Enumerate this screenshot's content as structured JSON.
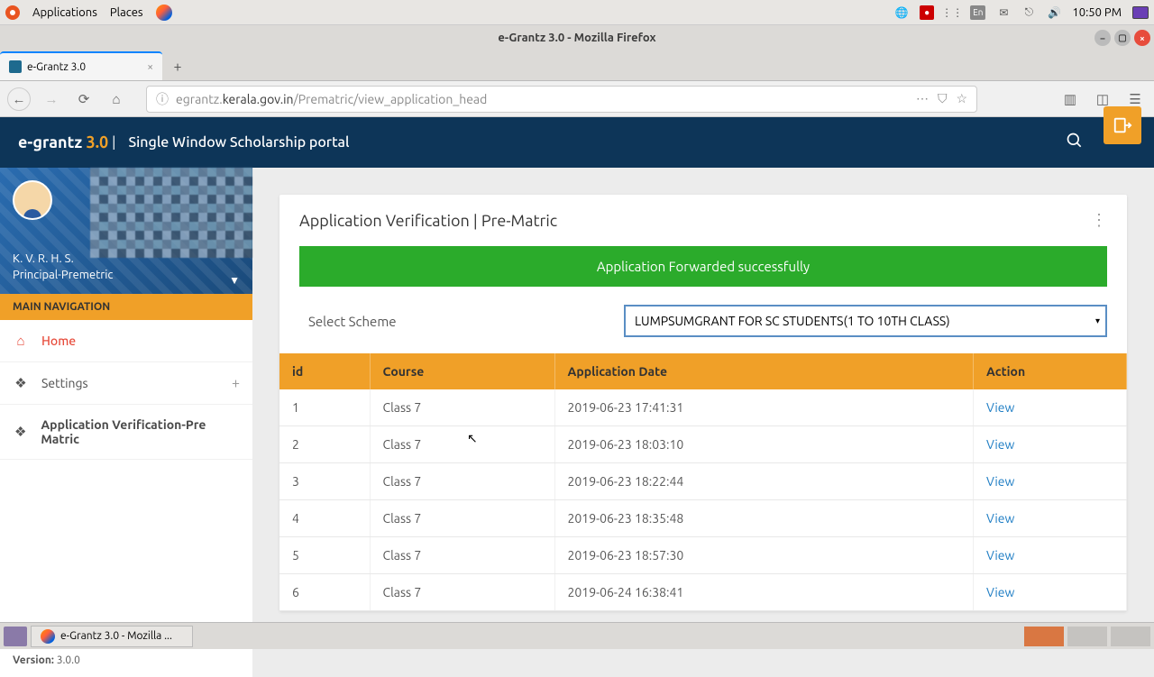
{
  "gnome": {
    "applications": "Applications",
    "places": "Places",
    "lang": "En",
    "time": "10:50 PM"
  },
  "firefox": {
    "window_title": "e-Grantz 3.0 - Mozilla Firefox",
    "tab_title": "e-Grantz 3.0",
    "url_prefix": "egrantz.",
    "url_domain": "kerala.gov.in",
    "url_path": "/Prematric/view_application_head"
  },
  "header": {
    "brand": "e-grantz ",
    "brand_ver": "3.0",
    "divider": " | ",
    "subtitle": "Single Window Scholarship portal"
  },
  "user": {
    "name": "K. V. R. H. S.",
    "role": "Principal-Premetric"
  },
  "nav": {
    "title": "MAIN NAVIGATION",
    "home": "Home",
    "settings": "Settings",
    "verification": "Application Verification-Pre Matric"
  },
  "footer": {
    "version_label": "Version: ",
    "version_value": "3.0.0"
  },
  "panel": {
    "title": "Application Verification | Pre-Matric",
    "alert": "Application Forwarded successfully",
    "scheme_label": "Select Scheme",
    "scheme_selected": "LUMPSUMGRANT FOR SC STUDENTS(1 TO 10TH CLASS)"
  },
  "table": {
    "headers": {
      "id": "id",
      "course": "Course",
      "date": "Application Date",
      "action": "Action"
    },
    "action_label": "View",
    "rows": [
      {
        "id": "1",
        "course": "Class 7",
        "date": "2019-06-23 17:41:31"
      },
      {
        "id": "2",
        "course": "Class 7",
        "date": "2019-06-23 18:03:10"
      },
      {
        "id": "3",
        "course": "Class 7",
        "date": "2019-06-23 18:22:44"
      },
      {
        "id": "4",
        "course": "Class 7",
        "date": "2019-06-23 18:35:48"
      },
      {
        "id": "5",
        "course": "Class 7",
        "date": "2019-06-23 18:57:30"
      },
      {
        "id": "6",
        "course": "Class 7",
        "date": "2019-06-24 16:38:41"
      }
    ]
  },
  "taskbar": {
    "app": "e-Grantz 3.0 - Mozilla ..."
  }
}
